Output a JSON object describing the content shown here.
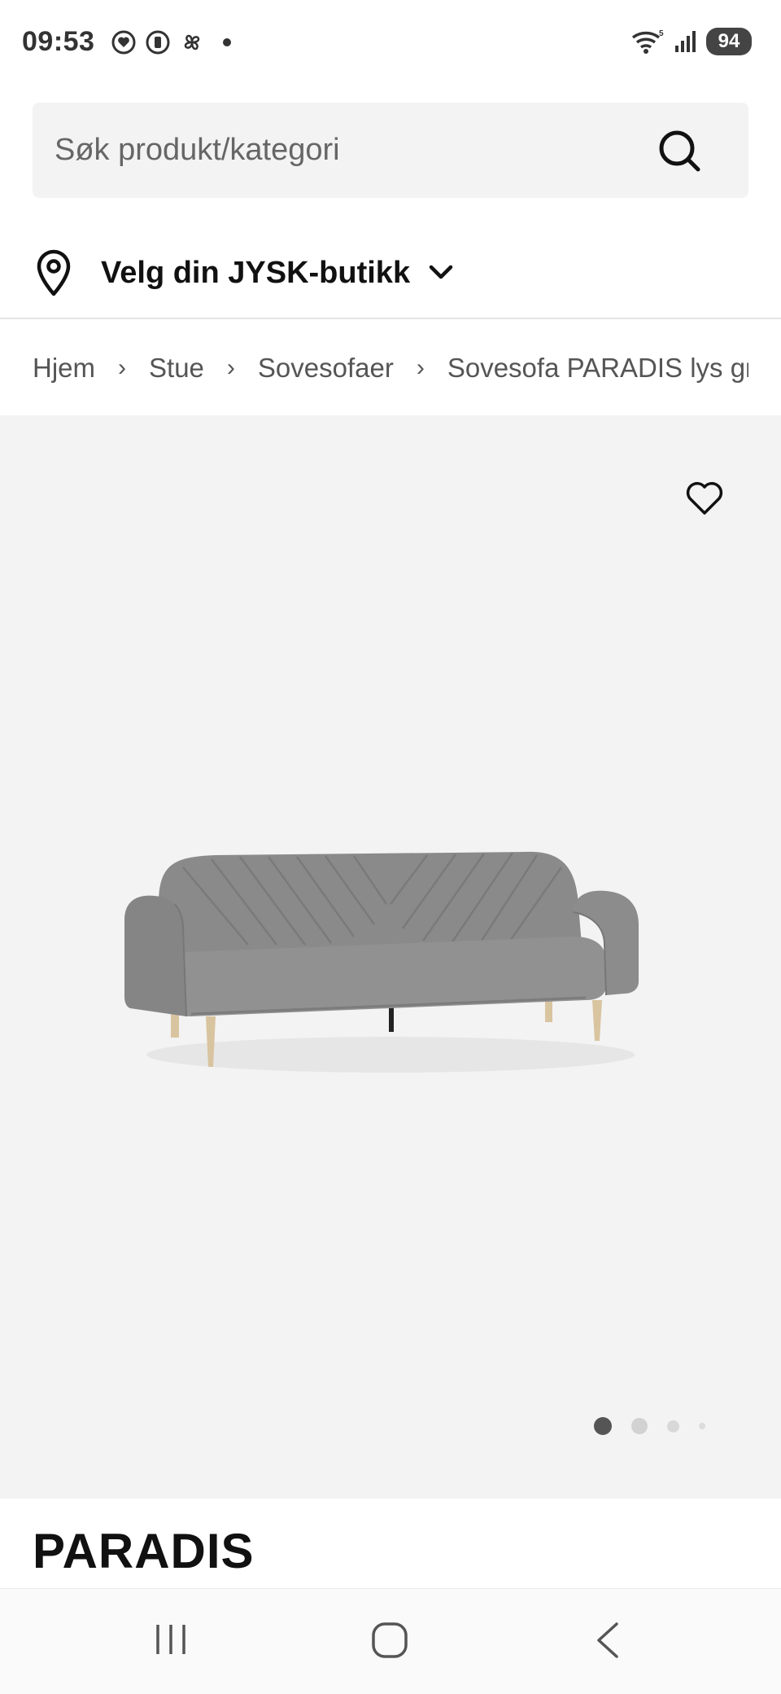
{
  "status_bar": {
    "time": "09:53",
    "battery": "94",
    "icons": [
      "heart-circle-icon",
      "phone-circle-icon",
      "pinwheel-icon",
      "wifi-icon",
      "signal-icon"
    ]
  },
  "search": {
    "placeholder": "Søk produkt/kategori"
  },
  "store": {
    "label": "Velg din JYSK-butikk"
  },
  "breadcrumb": {
    "items": [
      "Hjem",
      "Stue",
      "Sovesofaer",
      "Sovesofa PARADIS lys grå s"
    ],
    "separator": "›"
  },
  "product": {
    "title": "PARADIS",
    "image_count": 4,
    "active_image": 1
  },
  "colors": {
    "image_bg": "#f3f3f3",
    "sofa_fabric": "#8a8a8a",
    "wood_legs": "#d9c4a0"
  }
}
